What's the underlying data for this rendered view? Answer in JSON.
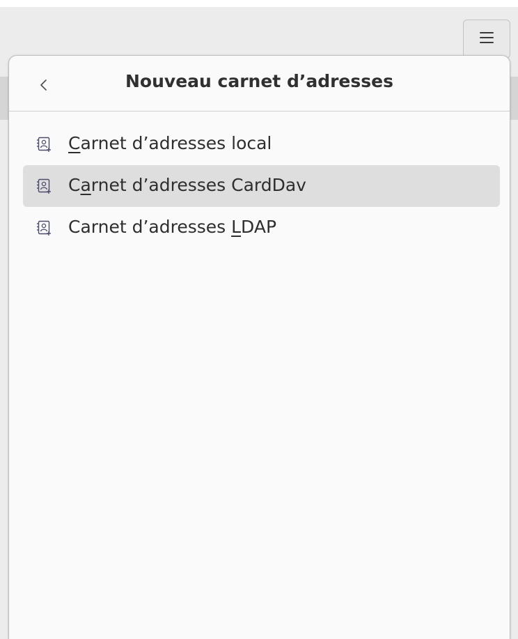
{
  "popover": {
    "title": "Nouveau carnet d’adresses",
    "back_icon": "chevron-left-icon"
  },
  "menu_button": {
    "icon": "hamburger-menu-icon"
  },
  "items": [
    {
      "before": "",
      "mnemonic": "C",
      "after": "arnet d’adresses local",
      "icon": "address-book-new-icon",
      "hover": false
    },
    {
      "before": "C",
      "mnemonic": "a",
      "after": "rnet d’adresses CardDav",
      "icon": "address-book-new-icon",
      "hover": true
    },
    {
      "before": "Carnet d’adresses ",
      "mnemonic": "L",
      "after": "DAP",
      "icon": "address-book-new-icon",
      "hover": false
    }
  ],
  "colors": {
    "hover_background": "#dedede",
    "popover_background": "#fafafa",
    "icon_stroke": "#4a4a6a"
  }
}
